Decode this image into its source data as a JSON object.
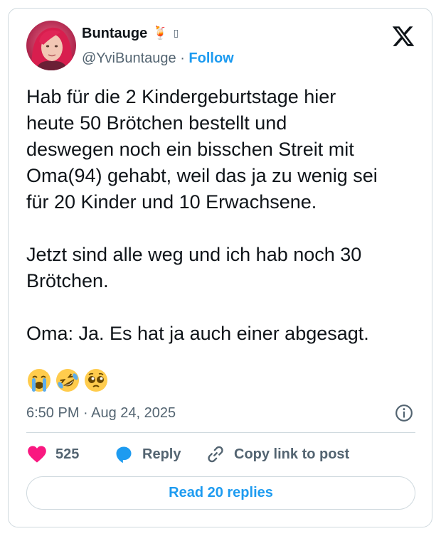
{
  "author": {
    "display_name": "Buntauge",
    "name_emoji": "🍹",
    "name_extra_glyph": "▯",
    "handle": "@YviBuntauge",
    "separator": "·",
    "follow_label": "Follow"
  },
  "tweet": {
    "text": "Hab für die 2 Kindergeburtstage hier\nheute 50 Brötchen bestellt und\ndeswegen noch ein bisschen Streit mit\nOma(94) gehabt, weil das ja zu wenig sei\nfür 20 Kinder und 10 Erwachsene.\n\nJetzt sind alle weg und ich hab noch 30\nBrötchen.\n\nOma: Ja. Es hat ja auch einer abgesagt.",
    "emojis": [
      "loudly-crying-face",
      "rolling-on-the-floor-laughing-face",
      "pleading-face"
    ],
    "timestamp": "6:50 PM · Aug 24, 2025"
  },
  "actions": {
    "like_count": "525",
    "reply_label": "Reply",
    "copy_link_label": "Copy link to post"
  },
  "read_replies_label": "Read 20 replies",
  "colors": {
    "accent": "#1d9bf0",
    "like": "#f91880",
    "text": "#0f1419",
    "muted": "#536471",
    "border": "#cfd9de"
  }
}
